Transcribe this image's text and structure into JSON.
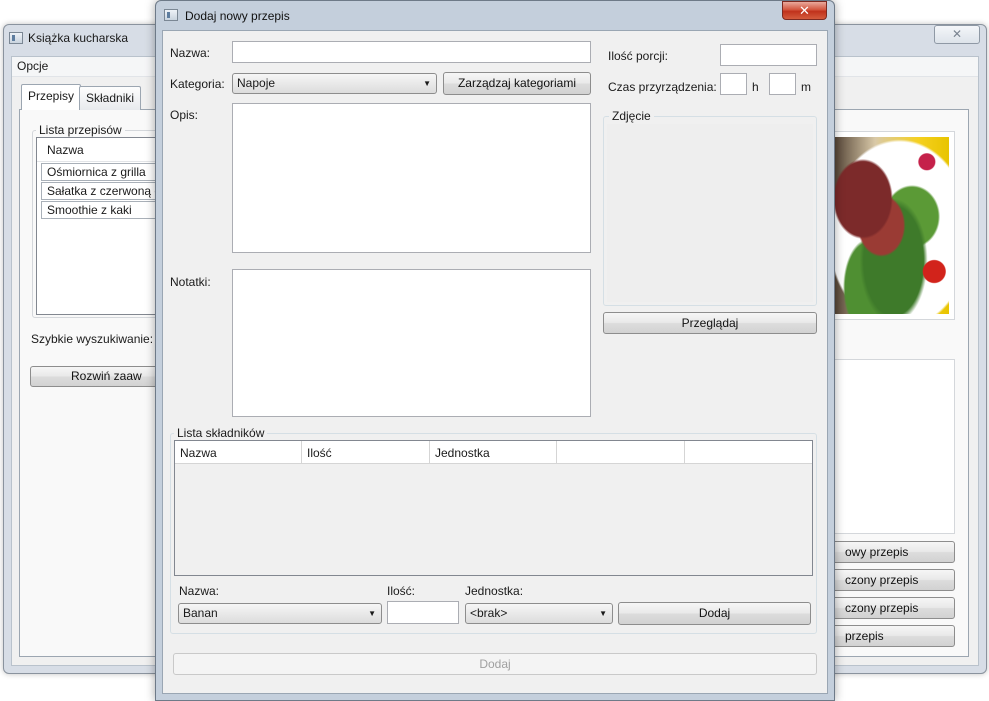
{
  "main_window": {
    "title": "Książka kucharska",
    "close_label": "✕",
    "menu": [
      "Opcje"
    ],
    "tabs": [
      "Przepisy",
      "Składniki"
    ],
    "recipe_list": {
      "group_label": "Lista przepisów",
      "column_header": "Nazwa",
      "items": [
        "Ośmiornica z grilla",
        "Sałatka z czerwoną c",
        "Smoothie z kaki"
      ]
    },
    "quick_search_label": "Szybkie wyszukiwanie:",
    "expand_button": "Rozwiń zaaw",
    "right_buttons": [
      "owy przepis",
      "czony przepis",
      "czony przepis",
      "przepis"
    ]
  },
  "dialog": {
    "title": "Dodaj nowy przepis",
    "close_label": "✕",
    "name_label": "Nazwa:",
    "name_value": "",
    "category_label": "Kategoria:",
    "category_value": "Napoje",
    "manage_categories_button": "Zarządzaj kategoriami",
    "description_label": "Opis:",
    "notes_label": "Notatki:",
    "portions_label": "Ilość porcji:",
    "portions_value": "",
    "prep_time_label": "Czas przyrządzenia:",
    "hours_value": "",
    "hours_unit": "h",
    "minutes_value": "",
    "minutes_unit": "m",
    "photo_group_label": "Zdjęcie",
    "browse_button": "Przeglądaj",
    "ingredients_group_label": "Lista składników",
    "ingredients_columns": [
      "Nazwa",
      "Ilość",
      "Jednostka",
      "",
      ""
    ],
    "ingredient_name_label": "Nazwa:",
    "ingredient_name_value": "Banan",
    "ingredient_amount_label": "Ilość:",
    "ingredient_amount_value": "",
    "ingredient_unit_label": "Jednostka:",
    "ingredient_unit_value": "<brak>",
    "add_ingredient_button": "Dodaj",
    "submit_button": "Dodaj"
  },
  "icons": {
    "combo_arrow": "▼"
  }
}
